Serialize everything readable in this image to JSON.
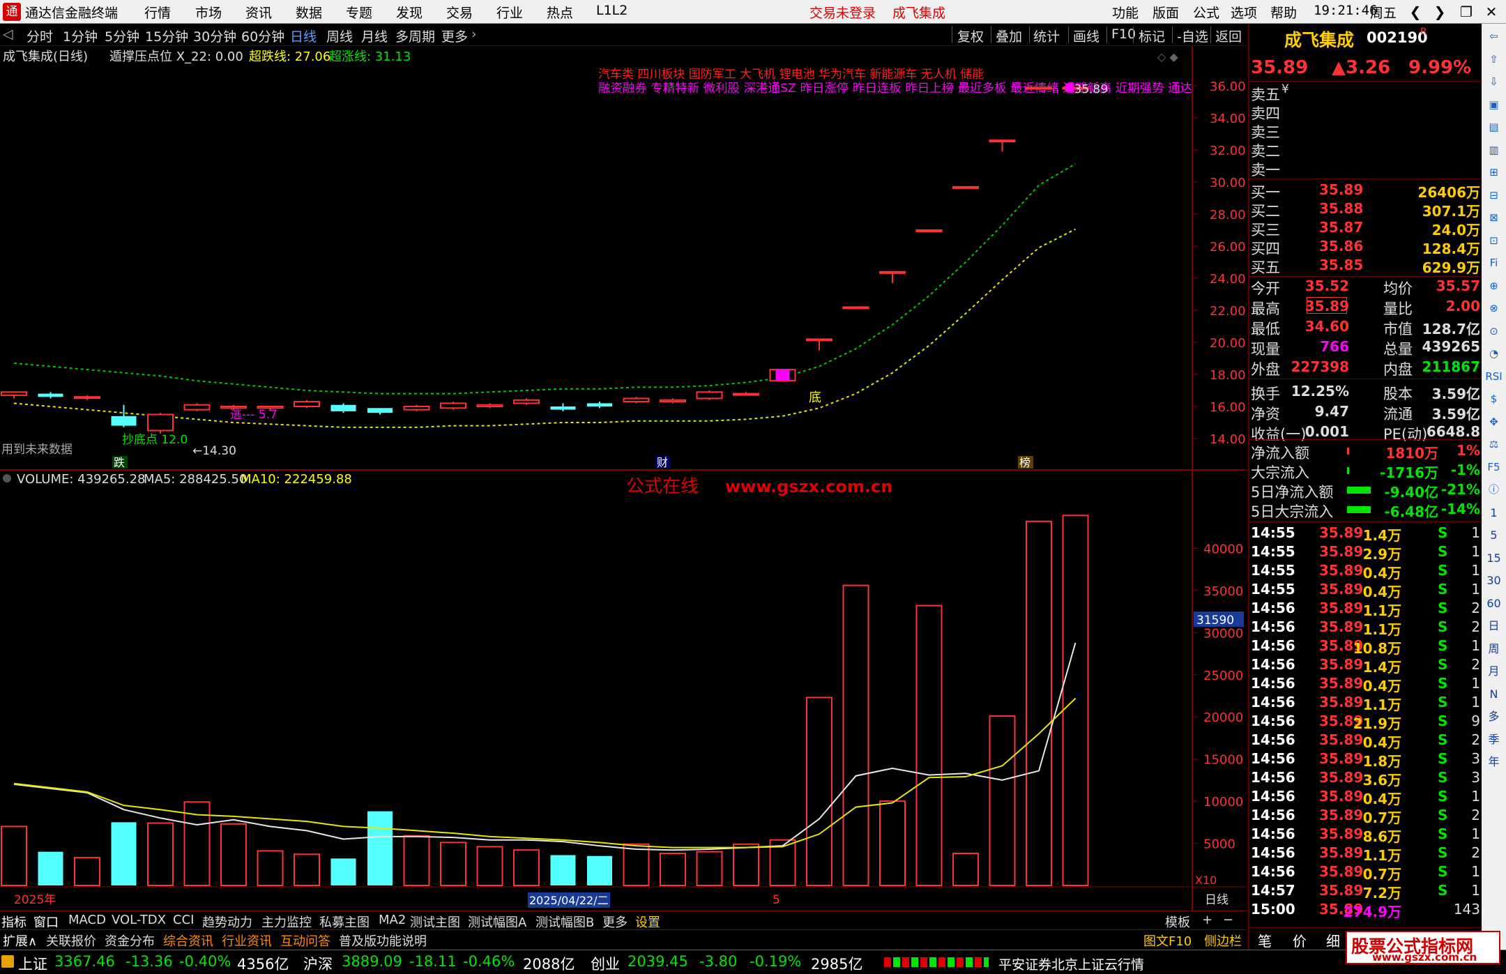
{
  "menubar": {
    "app_title": "通达信金融终端",
    "menus": [
      "行情",
      "市场",
      "资讯",
      "数据",
      "专题",
      "发现",
      "交易",
      "行业",
      "热点",
      "L1L2"
    ],
    "trade_status": "交易未登录",
    "stock_name_center": "成飞集成",
    "right_menus": [
      "功能",
      "版面",
      "公式",
      "选项",
      "帮助"
    ],
    "time": "19:21:46",
    "weekday": "周五",
    "window_buttons": [
      "❮",
      "❯",
      "❐",
      "✕"
    ]
  },
  "periods": [
    "分时",
    "1分钟",
    "5分钟",
    "15分钟",
    "30分钟",
    "60分钟",
    "日线",
    "周线",
    "月线",
    "多周期",
    "更多"
  ],
  "active_period": "日线",
  "chart_tools": [
    "复权",
    "叠加",
    "统计",
    "画线",
    "F10",
    "标记",
    "-自选",
    "返回"
  ],
  "indicator_line": {
    "name": "成飞集成(日线)",
    "formula": "遁撑压点位",
    "x22": "X_22: 0.00",
    "cdx": "超跌线: 27.06",
    "czx": "超涨线: 31.13"
  },
  "concept_line1": "汽车类     四川板块  国防军工  大飞机  锂电池  华为汽车  新能源车  无人机  储能",
  "concept_line2": "融资融券  专精特新  微利股  深港通SZ  昨日涨停  昨日连板  昨日上榜  最近多板  最近情绪  近期新高  近期强势  通达",
  "price_axis": [
    "36.00",
    "34.00",
    "32.00",
    "30.00",
    "28.00",
    "26.00",
    "24.00",
    "22.00",
    "20.00",
    "18.00",
    "16.00",
    "14.00"
  ],
  "annotations": {
    "last_price_marker": "35.89",
    "low_marker": "←14.30",
    "chaodi": "抄底点 12.0",
    "flee": "逃--- 5.7",
    "bottom": "底",
    "future_data": "用到未来数据",
    "marker_die": "跌",
    "marker_cai": "财",
    "marker_bang": "榜"
  },
  "volume_title": {
    "name": "VOLUME: 439265.28",
    "ma5": "MA5: 288425.50",
    "ma10": "MA10: 222459.88"
  },
  "volume_axis": [
    "40000",
    "35000",
    "30000",
    "25000",
    "20000",
    "15000",
    "10000",
    "5000"
  ],
  "volume_cursor": "31590",
  "volume_unit": "X10",
  "site_watermark": {
    "zh": "公式在线",
    "url": "www.gszx.com.cn"
  },
  "date_axis": {
    "year": "2025年",
    "cursor_date": "2025/04/22/二",
    "month": "5",
    "period_label": "日线"
  },
  "chart_data": {
    "type": "candlestick",
    "x": [
      "2025-04-01",
      "2025-04-02",
      "2025-04-03",
      "2025-04-07",
      "2025-04-08",
      "2025-04-09",
      "2025-04-10",
      "2025-04-11",
      "2025-04-14",
      "2025-04-15",
      "2025-04-16",
      "2025-04-17",
      "2025-04-18",
      "2025-04-21",
      "2025-04-22",
      "2025-04-23",
      "2025-04-24",
      "2025-04-25",
      "2025-04-28",
      "2025-04-29",
      "2025-04-30",
      "2025-05-06",
      "2025-05-07",
      "2025-05-08",
      "2025-05-09",
      "2025-05-12",
      "2025-05-13",
      "2025-05-14",
      "2025-05-15",
      "2025-05-16"
    ],
    "open": [
      16.7,
      16.8,
      16.6,
      15.4,
      14.5,
      15.8,
      15.9,
      15.9,
      16.0,
      16.1,
      15.9,
      15.8,
      15.9,
      16.0,
      16.2,
      16.0,
      16.2,
      16.3,
      16.3,
      16.5,
      16.8,
      17.6,
      20.2,
      22.2,
      24.4,
      27.0,
      29.7,
      32.6,
      35.89,
      35.89
    ],
    "close": [
      16.9,
      16.6,
      16.6,
      14.8,
      15.5,
      16.1,
      16.0,
      16.0,
      16.3,
      15.7,
      15.6,
      16.0,
      16.2,
      16.1,
      16.4,
      15.8,
      16.0,
      16.5,
      16.4,
      16.9,
      16.8,
      18.3,
      20.2,
      22.2,
      24.4,
      27.0,
      29.7,
      32.6,
      35.89,
      35.89
    ],
    "high": [
      16.9,
      16.9,
      16.7,
      16.1,
      15.6,
      16.2,
      16.1,
      16.0,
      16.4,
      16.2,
      15.9,
      16.1,
      16.3,
      16.2,
      16.5,
      16.2,
      16.3,
      16.6,
      16.5,
      17.0,
      16.9,
      18.3,
      20.2,
      22.2,
      24.4,
      27.0,
      29.7,
      32.6,
      35.89,
      35.89
    ],
    "low": [
      16.5,
      16.5,
      16.4,
      14.7,
      14.3,
      15.7,
      15.8,
      15.7,
      15.9,
      15.6,
      15.5,
      15.7,
      15.8,
      15.9,
      16.1,
      15.7,
      15.9,
      16.2,
      16.2,
      16.4,
      16.7,
      17.6,
      19.5,
      22.2,
      23.7,
      27.0,
      29.7,
      31.9,
      35.89,
      35.89
    ],
    "upper_band": [
      18.7,
      18.5,
      18.3,
      18.1,
      17.9,
      17.6,
      17.4,
      17.2,
      17.0,
      16.9,
      16.8,
      16.8,
      16.8,
      16.9,
      17.0,
      17.1,
      17.1,
      17.2,
      17.2,
      17.3,
      17.5,
      17.8,
      18.5,
      19.6,
      21.1,
      22.9,
      25.0,
      27.3,
      29.8,
      31.13
    ],
    "lower_band": [
      16.2,
      16.0,
      15.8,
      15.6,
      15.4,
      15.2,
      15.0,
      14.9,
      14.8,
      14.7,
      14.7,
      14.7,
      14.8,
      14.8,
      14.9,
      15.0,
      15.0,
      15.1,
      15.1,
      15.1,
      15.2,
      15.4,
      15.9,
      16.8,
      18.1,
      19.8,
      21.8,
      23.9,
      25.9,
      27.06
    ],
    "volume": [
      7000,
      4000,
      3300,
      7500,
      7400,
      9900,
      7300,
      4100,
      3700,
      3200,
      8800,
      5900,
      5100,
      4600,
      4200,
      3600,
      3500,
      4900,
      3800,
      4000,
      4900,
      5400,
      22300,
      35600,
      10000,
      33200,
      3800,
      20100,
      43200,
      43900
    ],
    "ma5": [
      12000,
      11500,
      11000,
      9000,
      8000,
      7200,
      7800,
      7000,
      6500,
      5500,
      5800,
      5800,
      5700,
      5400,
      5400,
      5200,
      4700,
      4300,
      4200,
      4300,
      4500,
      4700,
      7900,
      13000,
      13900,
      13100,
      13300,
      12500,
      13600,
      28800
    ],
    "ma10": [
      12100,
      11600,
      11100,
      9500,
      9000,
      8400,
      8200,
      7900,
      7600,
      7000,
      6800,
      6500,
      6200,
      5800,
      5600,
      5400,
      5100,
      4700,
      4500,
      4500,
      4500,
      4600,
      6100,
      9300,
      9800,
      12800,
      12900,
      14200,
      18000,
      22200
    ],
    "ylim": [
      13,
      37
    ],
    "vol_ylim": [
      0,
      45000
    ]
  },
  "right_panel": {
    "stock_name": "成飞集成",
    "stock_code": "002190",
    "r_flag": "R",
    "price": "35.89",
    "change": "▲3.26",
    "change_pct": "9.99%",
    "sell_levels": [
      {
        "label": "卖五",
        "price": "",
        "vol": "",
        "suffix": "¥"
      },
      {
        "label": "卖四",
        "price": "",
        "vol": ""
      },
      {
        "label": "卖三",
        "price": "",
        "vol": ""
      },
      {
        "label": "卖二",
        "price": "",
        "vol": ""
      },
      {
        "label": "卖一",
        "price": "",
        "vol": ""
      }
    ],
    "buy_levels": [
      {
        "label": "买一",
        "price": "35.89",
        "vol": "26406万"
      },
      {
        "label": "买二",
        "price": "35.88",
        "vol": "307.1万"
      },
      {
        "label": "买三",
        "price": "35.87",
        "vol": "24.0万"
      },
      {
        "label": "买四",
        "price": "35.86",
        "vol": "128.4万"
      },
      {
        "label": "买五",
        "price": "35.85",
        "vol": "629.9万"
      }
    ],
    "stats": [
      {
        "l1": "今开",
        "v1": "35.52",
        "l2": "均价",
        "v2": "35.57"
      },
      {
        "l1": "最高",
        "v1": "35.89",
        "l2": "量比",
        "v2": "2.00"
      },
      {
        "l1": "最低",
        "v1": "34.60",
        "l2": "市值",
        "v2": "128.7亿"
      },
      {
        "l1": "现量",
        "v1": "766",
        "l2": "总量",
        "v2": "439265"
      },
      {
        "l1": "外盘",
        "v1": "227398",
        "l2": "内盘",
        "v2": "211867"
      },
      {
        "l1": "换手",
        "v1": "12.25%",
        "l2": "股本",
        "v2": "3.59亿"
      },
      {
        "l1": "净资",
        "v1": "9.47",
        "l2": "流通",
        "v2": "3.59亿"
      },
      {
        "l1": "收益(一)",
        "v1": "0.001",
        "l2": "PE(动)",
        "v2": "6648.8"
      }
    ],
    "flows": [
      {
        "label": "净流入额",
        "val": "1810万",
        "pct": "1%"
      },
      {
        "label": "大宗流入",
        "val": "-1716万",
        "pct": "-1%"
      },
      {
        "label": "5日净流入额",
        "val": "-9.40亿",
        "pct": "-21%"
      },
      {
        "label": "5日大宗流入",
        "val": "-6.48亿",
        "pct": "-14%"
      }
    ],
    "ticks": [
      {
        "t": "14:55",
        "p": "35.89",
        "v": "1.4万",
        "s": "S",
        "n": "1"
      },
      {
        "t": "14:55",
        "p": "35.89",
        "v": "2.9万",
        "s": "S",
        "n": "1"
      },
      {
        "t": "14:55",
        "p": "35.89",
        "v": "0.4万",
        "s": "S",
        "n": "1"
      },
      {
        "t": "14:55",
        "p": "35.89",
        "v": "0.4万",
        "s": "S",
        "n": "1"
      },
      {
        "t": "14:56",
        "p": "35.89",
        "v": "1.1万",
        "s": "S",
        "n": "2"
      },
      {
        "t": "14:56",
        "p": "35.89",
        "v": "1.1万",
        "s": "S",
        "n": "2"
      },
      {
        "t": "14:56",
        "p": "35.89",
        "v": "10.8万",
        "s": "S",
        "n": "1"
      },
      {
        "t": "14:56",
        "p": "35.89",
        "v": "1.4万",
        "s": "S",
        "n": "2"
      },
      {
        "t": "14:56",
        "p": "35.89",
        "v": "0.4万",
        "s": "S",
        "n": "1"
      },
      {
        "t": "14:56",
        "p": "35.89",
        "v": "1.1万",
        "s": "S",
        "n": "1"
      },
      {
        "t": "14:56",
        "p": "35.89",
        "v": "21.9万",
        "s": "S",
        "n": "9"
      },
      {
        "t": "14:56",
        "p": "35.89",
        "v": "0.4万",
        "s": "S",
        "n": "2"
      },
      {
        "t": "14:56",
        "p": "35.89",
        "v": "1.8万",
        "s": "S",
        "n": "3"
      },
      {
        "t": "14:56",
        "p": "35.89",
        "v": "3.6万",
        "s": "S",
        "n": "3"
      },
      {
        "t": "14:56",
        "p": "35.89",
        "v": "0.4万",
        "s": "S",
        "n": "1"
      },
      {
        "t": "14:56",
        "p": "35.89",
        "v": "0.7万",
        "s": "S",
        "n": "2"
      },
      {
        "t": "14:56",
        "p": "35.89",
        "v": "8.6万",
        "s": "S",
        "n": "1"
      },
      {
        "t": "14:56",
        "p": "35.89",
        "v": "1.1万",
        "s": "S",
        "n": "2"
      },
      {
        "t": "14:56",
        "p": "35.89",
        "v": "0.7万",
        "s": "S",
        "n": "1"
      },
      {
        "t": "14:57",
        "p": "35.89",
        "v": "7.2万",
        "s": "S",
        "n": "1"
      },
      {
        "t": "15:00",
        "p": "35.89",
        "v": "274.9万",
        "s": "",
        "n": "143"
      }
    ],
    "bottom_tabs": [
      "笔",
      "价",
      "细",
      "势"
    ]
  },
  "sidebar_icons": [
    "⇦",
    "⇧",
    "⇩",
    "▣",
    "▤",
    "▥",
    "⊞",
    "⊟",
    "⊠",
    "⊡",
    "Fi",
    "⊕",
    "⊗",
    "⊙",
    "◔",
    "RSI",
    "$",
    "✥",
    "⚖",
    "F5",
    "ⓘ",
    "1",
    "5",
    "15",
    "30",
    "60",
    "日",
    "周",
    "月",
    "N",
    "多",
    "季",
    "年"
  ],
  "tabs_row1": [
    "指标",
    "窗口",
    "MACD",
    "VOL-TDX",
    "CCI",
    "趋势动力",
    "主力监控",
    "私募主图",
    "MA2",
    "测试主图",
    "测试幅图A",
    "测试幅图B",
    "更多",
    "设置"
  ],
  "tabs_row1_right": [
    "模板",
    "+",
    "−"
  ],
  "tabs_row2": [
    "扩展∧",
    "关联报价",
    "资金分布",
    "综合资讯",
    "行业资讯",
    "互动问答",
    "普及版功能说明"
  ],
  "tabs_row2_right": [
    "图文F10",
    "侧边栏《"
  ],
  "statusbar": {
    "sh_label": "上证",
    "sh_val": "3367.46",
    "sh_chg": "-13.36",
    "sh_pct": "-0.40%",
    "sh_amt": "4356亿",
    "hs_label": "沪深",
    "hs_val": "3889.09",
    "hs_chg": "-18.11",
    "hs_pct": "-0.46%",
    "hs_amt": "2088亿",
    "cy_label": "创业",
    "cy_val": "2039.45",
    "cy_chg": "-3.80",
    "cy_pct": "-0.19%",
    "cy_amt": "2985亿",
    "broker": "平安证券北京上证云行情"
  },
  "corner_watermark": {
    "text": "股票公式指标网",
    "url": "www.gszx.com.cn"
  },
  "colors": {
    "up": "#ff3232",
    "down": "#54ffff",
    "yellow": "#ffff00",
    "magenta": "#ff00ff",
    "green": "#00e600",
    "grid": "#800000"
  }
}
